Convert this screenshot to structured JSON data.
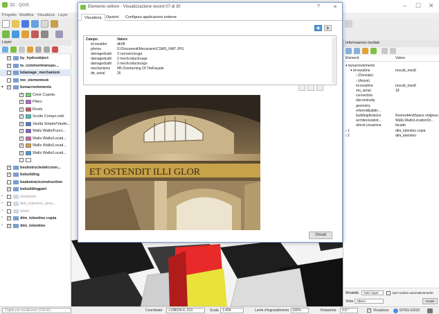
{
  "app": {
    "title": "3D - QGIS",
    "window_controls": [
      "–",
      "☐",
      "✕"
    ]
  },
  "menu": [
    "Progetto",
    "Modifica",
    "Visualizza",
    "Layer"
  ],
  "layers_panel": {
    "title": "Layer",
    "items": [
      {
        "label": "by_hydroobject",
        "indent": 22,
        "checked": true,
        "bold": true
      },
      {
        "label": "ta_commontranspo...",
        "indent": 22,
        "checked": true,
        "bold": true
      },
      {
        "label": "bdamage_mechanism",
        "indent": 22,
        "checked": false,
        "bold": true,
        "highlight": true
      },
      {
        "label": "mo_elementesk",
        "indent": 22,
        "checked": false,
        "bold": true
      },
      {
        "label": "bunacreelements",
        "indent": 22,
        "checked": true,
        "bold": true,
        "expanded": true
      },
      {
        "label": "Cene Cupola",
        "indent": 40,
        "checked": true,
        "swatch": "#6fd96f"
      },
      {
        "label": "Pilers",
        "indent": 40,
        "checked": true,
        "swatch": "#c85ae0"
      },
      {
        "label": "Roofs",
        "indent": 40,
        "checked": true,
        "swatch": "#e05050"
      },
      {
        "label": "Sculte Compo.rett/",
        "indent": 40,
        "checked": true,
        "swatch": "#3cc4c4"
      },
      {
        "label": "Vaulta Simple/Vaultu...",
        "indent": 40,
        "checked": true,
        "swatch": "#4a7ce0"
      },
      {
        "label": "Walls Walls/Funct...",
        "indent": 40,
        "checked": true,
        "swatch": "#8a5ae0"
      },
      {
        "label": "Walls Walls/Locati...",
        "indent": 40,
        "checked": true,
        "swatch": "#e05aa8"
      },
      {
        "label": "Walls Walls/Locati...",
        "indent": 40,
        "checked": true,
        "swatch": "#e0a03c"
      },
      {
        "label": "Walls Walls/Locati...",
        "indent": 40,
        "checked": true,
        "swatch": "#3c9ae0"
      },
      {
        "label": "",
        "indent": 40,
        "checked": false,
        "swatch": "#ffffff"
      },
      {
        "label": "bsubstructedelcrzon...",
        "indent": 22,
        "checked": true,
        "bold": true
      },
      {
        "label": "bsbuilding",
        "indent": 22,
        "checked": true,
        "bold": true
      },
      {
        "label": "bsabstractconstruction",
        "indent": 22,
        "checked": false,
        "bold": true
      },
      {
        "label": "bsbuildingpart",
        "indent": 22,
        "checked": true,
        "bold": true
      },
      {
        "label": "ortophoto",
        "indent": 22,
        "checked": false,
        "bold": false,
        "faded": true
      },
      {
        "label": "dtm_tolentino_area...",
        "indent": 22,
        "checked": false,
        "bold": false,
        "faded": true
      },
      {
        "label": "Istelo",
        "indent": 22,
        "checked": false,
        "bold": false,
        "faded": true
      },
      {
        "label": "dtm_tolentino copia",
        "indent": 22,
        "checked": true,
        "bold": true
      },
      {
        "label": "dtm_tolentino",
        "indent": 22,
        "checked": true,
        "bold": true
      }
    ],
    "search_placeholder": "Digita per localizzare (Ctrl+K)"
  },
  "dialog": {
    "title": "Elemento vettore - Visualizzazione record 07 di 30",
    "help": "?",
    "close": "✕",
    "tabs": [
      "Visualizza",
      "Opzioni",
      "Configura applicazioni esterne"
    ],
    "attr_headers": {
      "field": "Campo",
      "value": "Valore"
    },
    "attributes": [
      {
        "field": "id-resulttm",
        "value": "dtr08"
      },
      {
        "field": "photos",
        "value": "D:\\Documenti\\Mecanismi\\CSMS_0487.JPG"
      },
      {
        "field": "damagedcath",
        "value": "3 corrosion\\ruga"
      },
      {
        "field": "damagedcath",
        "value": "2 mechcoductrusgo"
      },
      {
        "field": "damagedcath",
        "value": "2 mechcoductrusgo"
      },
      {
        "field": "mechanisms",
        "value": "M5.Overturning.Of.TheFaçade"
      },
      {
        "field": "dtr_serial",
        "value": "26"
      }
    ],
    "close_button": "Chiudi"
  },
  "identify_panel": {
    "title": "Informazioni risultati",
    "col_feature": "Elementi",
    "col_value": "Valore",
    "rows": [
      {
        "indent": 3,
        "label": "▾  bunacreelements",
        "value": ""
      },
      {
        "indent": 10,
        "label": "▾  id-resultme",
        "value": "rescult_mes8"
      },
      {
        "indent": 18,
        "label": "›  (Derivato)",
        "value": ""
      },
      {
        "indent": 18,
        "label": "›  (Azioni)",
        "value": ""
      },
      {
        "indent": 18,
        "label": "id-resultme",
        "value": "rescult_mes8"
      },
      {
        "indent": 18,
        "label": "mo_serial",
        "value": "18"
      },
      {
        "indent": 18,
        "label": "connection",
        "value": ""
      },
      {
        "indent": 18,
        "label": "discontinuity",
        "value": ""
      },
      {
        "indent": 18,
        "label": "geometry",
        "value": ""
      },
      {
        "indent": 18,
        "label": "referredbuildin...",
        "value": ""
      },
      {
        "indent": 18,
        "label": "buildingdivisions",
        "value": "Rooms4AndSpace religious..."
      },
      {
        "indent": 18,
        "label": "architecturalstr...",
        "value": "Walls.Walls\\LocationOr..."
      },
      {
        "indent": 18,
        "label": "directi-creazione",
        "value": "facade"
      },
      {
        "indent": 3,
        "label": "›  1",
        "value": "dtm_tolentino copia"
      },
      {
        "indent": 3,
        "label": "›  2",
        "value": "dtm_tolentino"
      }
    ],
    "mode_label": "Modalità",
    "mode_value": "Tutti i layer",
    "auto_open": "Apri modulo automaticamente",
    "view_label": "Vista",
    "view_value": "Albero",
    "help_button": "Guida"
  },
  "statusbar": {
    "coord_label": "Coordinate",
    "coord_value": "+108034.4,-013",
    "scale_label": "Scala",
    "scale_value": "1:404",
    "magnifier_label": "Lente d'ingrandimento",
    "magnifier_value": "100%",
    "rotation_label": "Rotazione",
    "rotation_value": "0.0 °",
    "render_label": "Visualizza",
    "crs": "EPSG:32633"
  },
  "photo_text": "ET OSTENDIT ILLI GLOR",
  "colors": {
    "accent": "#4a90d9",
    "red": "#e82a2a",
    "yellow": "#e8e23a"
  }
}
